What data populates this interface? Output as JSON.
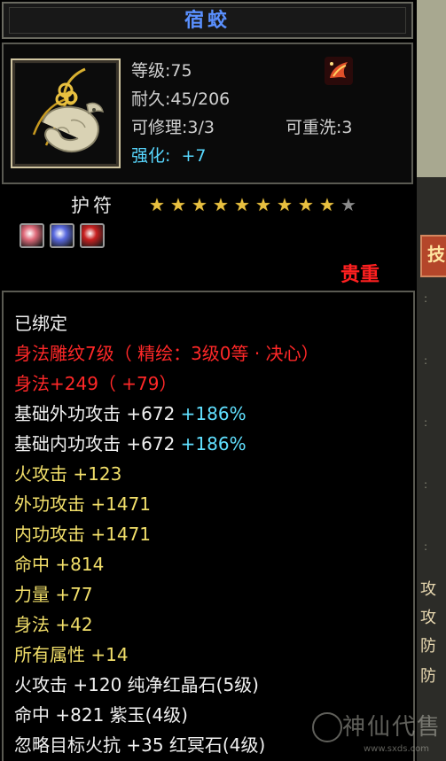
{
  "item": {
    "name": "宿蛟",
    "level_text": "等级:75",
    "durability_text": "耐久:45/206",
    "repairable_text": "可修理:3/3",
    "rewash_text": "可重洗:3",
    "enhance_label": "强化:",
    "enhance_value": "+7"
  },
  "talisman": {
    "label": "护符",
    "stars_filled": 9,
    "stars_total": 10
  },
  "gems": [
    {
      "icon": "pink-gem-icon",
      "color": "#e06a7a"
    },
    {
      "icon": "blue-gem-icon",
      "color": "#5a6ae0"
    },
    {
      "icon": "red-gem-icon",
      "color": "#c82020"
    }
  ],
  "rarity": "贵重",
  "attributes": [
    {
      "parts": [
        {
          "text": "已绑定",
          "color": "white"
        }
      ]
    },
    {
      "parts": [
        {
          "text": "身法雕纹7级（ 精绘：3级0等 · 决心）",
          "color": "red"
        }
      ]
    },
    {
      "parts": [
        {
          "text": "身法+249（ +79）",
          "color": "red"
        }
      ]
    },
    {
      "parts": [
        {
          "text": "基础外功攻击 +672 ",
          "color": "white"
        },
        {
          "text": "+186%",
          "color": "cyan"
        }
      ]
    },
    {
      "parts": [
        {
          "text": "基础内功攻击 +672 ",
          "color": "white"
        },
        {
          "text": "+186%",
          "color": "cyan"
        }
      ]
    },
    {
      "parts": [
        {
          "text": "火攻击 +123",
          "color": "yellow"
        }
      ]
    },
    {
      "parts": [
        {
          "text": "外功攻击 +1471",
          "color": "yellow"
        }
      ]
    },
    {
      "parts": [
        {
          "text": "内功攻击 +1471",
          "color": "yellow"
        }
      ]
    },
    {
      "parts": [
        {
          "text": "命中 +814",
          "color": "yellow"
        }
      ]
    },
    {
      "parts": [
        {
          "text": "力量 +77",
          "color": "yellow"
        }
      ]
    },
    {
      "parts": [
        {
          "text": "身法 +42",
          "color": "yellow"
        }
      ]
    },
    {
      "parts": [
        {
          "text": "所有属性 +14",
          "color": "yellow"
        }
      ]
    },
    {
      "parts": [
        {
          "text": "火攻击 +120 纯净红晶石(5级)",
          "color": "white"
        }
      ]
    },
    {
      "parts": [
        {
          "text": "命中 +821 紫玉(4级)",
          "color": "white"
        }
      ]
    },
    {
      "parts": [
        {
          "text": "忽略目标火抗 +35 红冥石(4级)",
          "color": "white"
        }
      ]
    }
  ],
  "side_panel": {
    "tab_label": "技",
    "chars": [
      "攻",
      "攻",
      "防",
      "防"
    ]
  },
  "watermark": {
    "title": "神仙代售",
    "url": "www.sxds.com"
  },
  "colors": {
    "title_blue": "#5a90ff",
    "red": "#ff2828",
    "yellow": "#f2df6a",
    "cyan": "#60e0ff"
  }
}
